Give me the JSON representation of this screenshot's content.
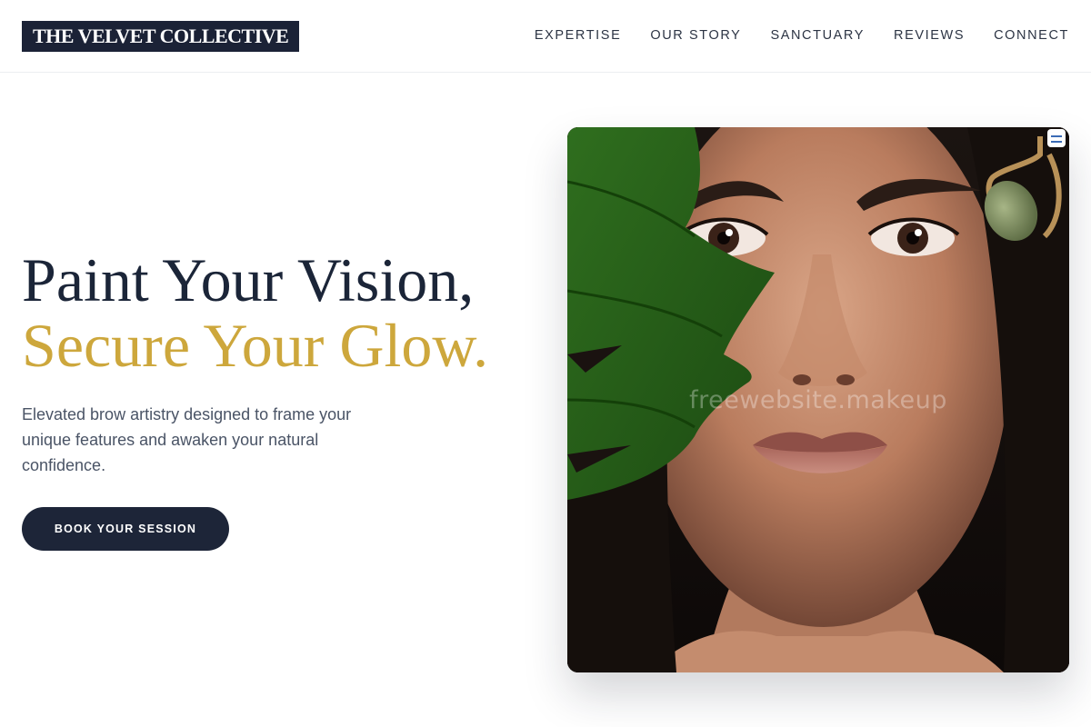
{
  "header": {
    "logo": "THE VELVET COLLECTIVE",
    "nav": [
      "EXPERTISE",
      "OUR STORY",
      "SANCTUARY",
      "REVIEWS",
      "CONNECT"
    ]
  },
  "hero": {
    "title_line1": "Paint Your Vision,",
    "title_line2": "Secure Your Glow.",
    "subtitle": "Elevated brow artistry designed to frame your unique features and awaken your natural confidence.",
    "cta_label": "BOOK YOUR SESSION",
    "image_watermark": "freewebsite.makeup"
  },
  "colors": {
    "navy": "#1b2236",
    "gold": "#cda73c",
    "text_muted": "#4a5466"
  },
  "icons": [
    "face-photo",
    "monstera-leaf",
    "jade-roller"
  ]
}
